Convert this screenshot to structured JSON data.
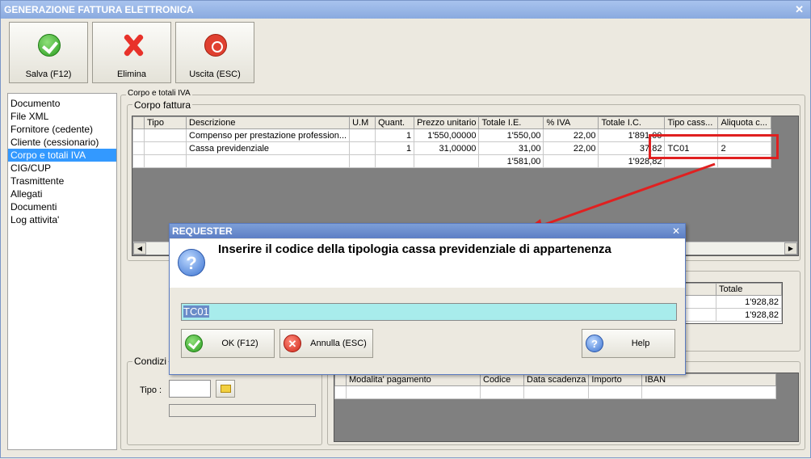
{
  "window": {
    "title": "GENERAZIONE FATTURA ELETTRONICA",
    "close_glyph": "✕"
  },
  "toolbar": {
    "save_label": "Salva (F12)",
    "delete_label": "Elimina",
    "exit_label": "Uscita (ESC)"
  },
  "sidebar": {
    "items": [
      {
        "label": "Documento"
      },
      {
        "label": "File XML"
      },
      {
        "label": "Fornitore (cedente)"
      },
      {
        "label": "Cliente (cessionario)"
      },
      {
        "label": "Corpo e totali IVA"
      },
      {
        "label": "CIG/CUP"
      },
      {
        "label": "Trasmittente"
      },
      {
        "label": "Allegati"
      },
      {
        "label": "Documenti"
      },
      {
        "label": "Log attivita'"
      }
    ],
    "selected_index": 4
  },
  "corpo": {
    "section_label": "Corpo e totali IVA",
    "group_label": "Corpo fattura",
    "columns": [
      "Tipo",
      "Descrizione",
      "U.M",
      "Quant.",
      "Prezzo unitario",
      "Totale I.E.",
      "% IVA",
      "Totale I.C.",
      "Tipo cass...",
      "Aliquota c..."
    ],
    "rows": [
      [
        "",
        "Compenso per prestazione profession...",
        "",
        "1",
        "1'550,00000",
        "1'550,00",
        "22,00",
        "1'891,00",
        "",
        ""
      ],
      [
        "",
        "Cassa previdenziale",
        "",
        "1",
        "31,00000",
        "31,00",
        "22,00",
        "37,82",
        "TC01",
        "2"
      ],
      [
        "",
        "",
        "",
        "",
        "",
        "1'581,00",
        "",
        "1'928,82",
        "",
        ""
      ]
    ]
  },
  "totali": {
    "column": "Totale",
    "rows": [
      "1'928,82",
      "1'928,82"
    ]
  },
  "condizioni": {
    "group_label": "Condizi",
    "tipo_label": "Tipo :"
  },
  "pagamenti": {
    "columns": [
      "Modalita' pagamento",
      "Codice",
      "Data scadenza",
      "Importo",
      "IBAN"
    ]
  },
  "dialog": {
    "title": "REQUESTER",
    "close_glyph": "✕",
    "prompt": "Inserire il codice della tipologia cassa previdenziale di appartenenza",
    "question_glyph": "?",
    "input_value": "TC01",
    "ok_label": "OK (F12)",
    "cancel_label": "Annulla (ESC)",
    "help_label": "Help"
  },
  "colors": {
    "highlight": "#e02020",
    "selection": "#3399ff",
    "input_bg": "#a8ecec"
  }
}
